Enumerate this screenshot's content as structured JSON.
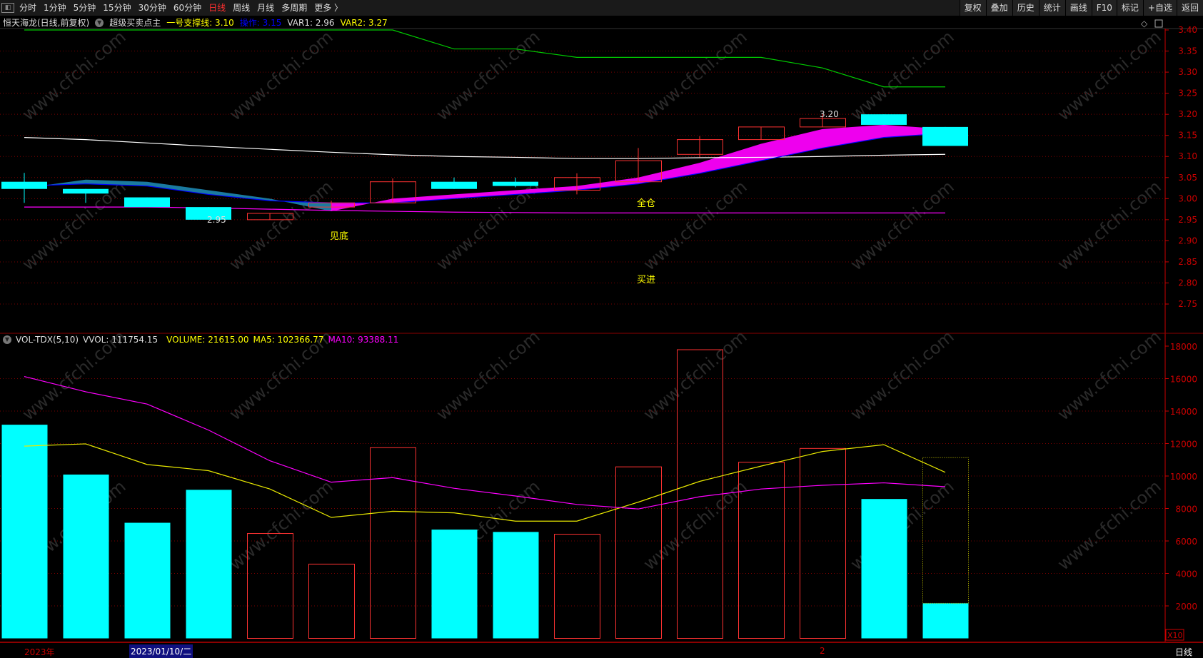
{
  "toolbar": {
    "periods": [
      "分时",
      "1分钟",
      "5分钟",
      "15分钟",
      "30分钟",
      "60分钟",
      "日线",
      "周线",
      "月线",
      "多周期",
      "更多 〉"
    ],
    "active": "日线",
    "right_buttons": [
      "复权",
      "叠加",
      "历史",
      "统计",
      "画线",
      "F10",
      "标记",
      "+自选",
      "返回"
    ]
  },
  "info": {
    "stock": "恒天海龙(日线,前复权)",
    "indicator": "超级买卖点主",
    "support": "一号支撑线: 3.10",
    "op": "操作: 3.15",
    "var1": "VAR1: 2.96",
    "var2": "VAR2: 3.27"
  },
  "volinfo": {
    "name": "VOL-TDX(5,10)",
    "vvol": "VVOL: 111754.15",
    "volume": "VOLUME: 21615.00",
    "ma5": "MA5: 102366.77",
    "ma10": "MA10: 93388.11"
  },
  "colors": {
    "up": "#ff3232",
    "down": "#00ffff",
    "axis": "#cc0000",
    "ma5": "#e8e800",
    "ma10": "#ff00ff",
    "support": "#ffffff",
    "var2": "#00cc00",
    "op": "#0000ff",
    "band_down": "#1a7aa0",
    "band_up": "#ee00ee",
    "var1": "#ff00ff"
  },
  "annotations": {
    "low": "2.95",
    "high": "3.20",
    "jiandi": "见底",
    "quancang": "全仓",
    "maijin": "买进"
  },
  "price_axis": [
    "3.40",
    "3.35",
    "3.30",
    "3.25",
    "3.20",
    "3.15",
    "3.10",
    "3.05",
    "3.00",
    "2.95",
    "2.90",
    "2.85",
    "2.80",
    "2.75"
  ],
  "vol_axis": [
    "18000",
    "16000",
    "14000",
    "12000",
    "10000",
    "8000",
    "6000",
    "4000",
    "2000"
  ],
  "vol_unit": "X10",
  "dates": {
    "year": "2023年",
    "cursor": "2023/01/10/二",
    "month": "2",
    "period": "日线"
  },
  "watermark": "www.cfchi.com",
  "candles": [
    {
      "o": 3.04,
      "c": 3.023,
      "h": 3.061,
      "l": 2.99
    },
    {
      "o": 3.023,
      "c": 3.012,
      "h": 3.023,
      "l": 2.99
    },
    {
      "o": 3.003,
      "c": 2.98,
      "h": 3.003,
      "l": 2.98
    },
    {
      "o": 2.98,
      "c": 2.95,
      "h": 2.98,
      "l": 2.95
    },
    {
      "o": 2.95,
      "c": 2.965,
      "h": 2.965,
      "l": 2.95
    },
    {
      "o": 2.98,
      "c": 2.99,
      "h": 2.995,
      "l": 2.98
    },
    {
      "o": 2.99,
      "c": 3.04,
      "h": 3.048,
      "l": 2.99
    },
    {
      "o": 3.04,
      "c": 3.023,
      "h": 3.05,
      "l": 3.023
    },
    {
      "o": 3.04,
      "c": 3.03,
      "h": 3.05,
      "l": 3.027
    },
    {
      "o": 3.02,
      "c": 3.05,
      "h": 3.06,
      "l": 3.01
    },
    {
      "o": 3.04,
      "c": 3.09,
      "h": 3.12,
      "l": 3.04
    },
    {
      "o": 3.105,
      "c": 3.14,
      "h": 3.148,
      "l": 3.098
    },
    {
      "o": 3.14,
      "c": 3.17,
      "h": 3.17,
      "l": 3.14
    },
    {
      "o": 3.17,
      "c": 3.19,
      "h": 3.2,
      "l": 3.17
    },
    {
      "o": 3.2,
      "c": 3.175,
      "h": 3.2,
      "l": 3.175
    },
    {
      "o": 3.17,
      "c": 3.125,
      "h": 3.17,
      "l": 3.125
    }
  ],
  "lines": {
    "var2": [
      3.4,
      3.4,
      3.4,
      3.4,
      3.4,
      3.4,
      3.4,
      3.355,
      3.355,
      3.335,
      3.335,
      3.335,
      3.335,
      3.31,
      3.265,
      3.265
    ],
    "support": [
      3.145,
      3.14,
      3.132,
      3.124,
      3.117,
      3.11,
      3.104,
      3.1,
      3.098,
      3.095,
      3.095,
      3.097,
      3.098,
      3.1,
      3.103,
      3.105
    ],
    "var1": [
      2.98,
      2.98,
      2.98,
      2.978,
      2.975,
      2.972,
      2.97,
      2.968,
      2.967,
      2.966,
      2.966,
      2.966,
      2.966,
      2.966,
      2.966,
      2.966
    ],
    "op": [
      3.03,
      3.035,
      3.03,
      3.01,
      2.995,
      2.99,
      2.99,
      3.0,
      3.01,
      3.02,
      3.035,
      3.06,
      3.09,
      3.12,
      3.145,
      3.155
    ],
    "band": [
      3.025,
      3.045,
      3.04,
      3.02,
      3.0,
      2.97,
      3.0,
      3.01,
      3.02,
      3.03,
      3.05,
      3.085,
      3.13,
      3.165,
      3.175,
      3.165
    ]
  },
  "volume": {
    "values": [
      13160,
      10090,
      7120,
      9150,
      6460,
      4575,
      11745,
      6700,
      6555,
      6415,
      10565,
      17780,
      10850,
      11700,
      8585,
      2160
    ],
    "projected_last": 11130,
    "ma5": [
      11840,
      11980,
      10710,
      10330,
      9200,
      7450,
      7830,
      7730,
      7220,
      7220,
      8390,
      9670,
      10610,
      11510,
      11930,
      10230
    ],
    "ma10": [
      16130,
      15190,
      14430,
      12830,
      10940,
      9620,
      9900,
      9245,
      8770,
      8250,
      7970,
      8725,
      9200,
      9430,
      9580,
      9340
    ]
  }
}
